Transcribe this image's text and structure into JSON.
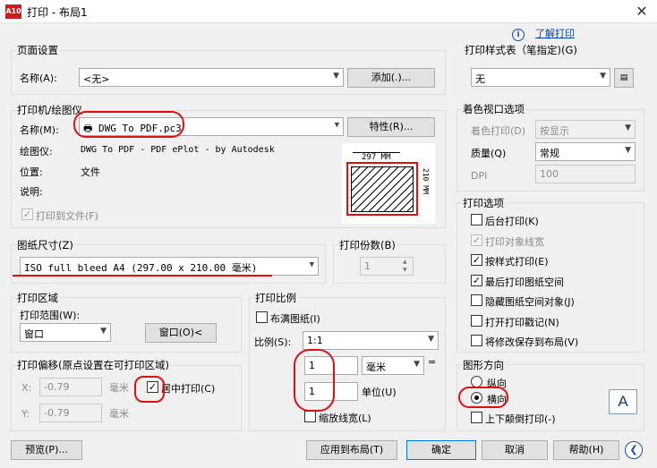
{
  "window": {
    "title": "打印 - 布局1",
    "app_icon_text": "A10",
    "help_link": "了解打印"
  },
  "page_setup": {
    "title": "页面设置",
    "name_label": "名称(A):",
    "name_value": "<无>",
    "add_button": "添加(.)..."
  },
  "printer": {
    "title": "打印机/绘图仪",
    "name_label": "名称(M):",
    "name_value": "DWG To PDF.pc3",
    "properties_button": "特性(R)...",
    "plotter_label": "绘图仪:",
    "plotter_value": "DWG To PDF - PDF ePlot - by Autodesk",
    "location_label": "位置:",
    "location_value": "文件",
    "description_label": "说明:",
    "print_to_file": "打印到文件(F)",
    "preview_width": "297 MM",
    "preview_height": "210 MM"
  },
  "paper_size": {
    "title": "图纸尺寸(Z)",
    "value": "ISO full bleed A4 (297.00 x 210.00 毫米)"
  },
  "copies": {
    "title": "打印份数(B)",
    "value": "1"
  },
  "plot_area": {
    "title": "打印区域",
    "range_label": "打印范围(W):",
    "range_value": "窗口",
    "window_button": "窗口(O)<"
  },
  "plot_offset": {
    "title": "打印偏移(原点设置在可打印区域)",
    "x_label": "X:",
    "x_value": "-0.79",
    "x_unit": "毫米",
    "y_label": "Y:",
    "y_value": "-0.79",
    "y_unit": "毫米",
    "center_label": "居中打印(C)"
  },
  "plot_scale": {
    "title": "打印比例",
    "fit_label": "布满图纸(I)",
    "scale_label": "比例(S):",
    "scale_value": "1:1",
    "value1": "1",
    "unit1": "毫米",
    "value2": "1",
    "unit2": "单位(U)",
    "lineweights": "缩放线宽(L)"
  },
  "style_table": {
    "title": "打印样式表（笔指定)(G)",
    "value": "无"
  },
  "shaded_viewport": {
    "title": "着色视口选项",
    "shade_label": "着色打印(D)",
    "shade_value": "按显示",
    "quality_label": "质量(Q)",
    "quality_value": "常规",
    "dpi_label": "DPI",
    "dpi_value": "100"
  },
  "plot_options": {
    "title": "打印选项",
    "items": [
      {
        "label": "后台打印(K)",
        "checked": false,
        "disabled": false
      },
      {
        "label": "打印对象线宽",
        "checked": true,
        "disabled": true
      },
      {
        "label": "按样式打印(E)",
        "checked": true,
        "disabled": false
      },
      {
        "label": "最后打印图纸空间",
        "checked": true,
        "disabled": false
      },
      {
        "label": "隐藏图纸空间对象(J)",
        "checked": false,
        "disabled": false
      },
      {
        "label": "打开打印戳记(N)",
        "checked": false,
        "disabled": false
      },
      {
        "label": "将修改保存到布局(V)",
        "checked": false,
        "disabled": false
      }
    ]
  },
  "orientation": {
    "title": "图形方向",
    "portrait": "纵向",
    "landscape": "横向",
    "upside_down": "上下颠倒打印(-)",
    "icon_letter": "A"
  },
  "footer": {
    "preview": "预览(P)...",
    "apply": "应用到布局(T)",
    "ok": "确定",
    "cancel": "取消",
    "help": "帮助(H)"
  }
}
